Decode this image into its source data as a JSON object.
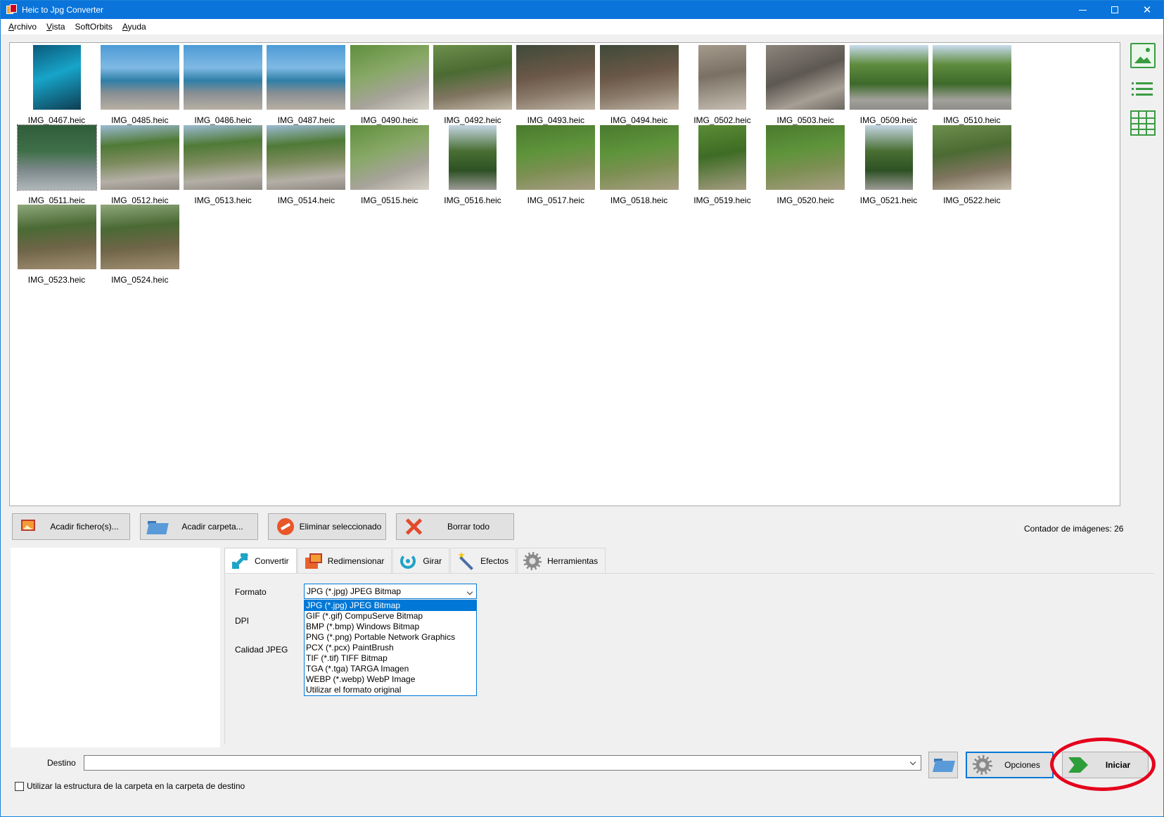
{
  "window": {
    "title": "Heic to Jpg Converter"
  },
  "menu": [
    {
      "u": "A",
      "rest": "rchivo"
    },
    {
      "u": "V",
      "rest": "ista"
    },
    {
      "u": "",
      "rest": "SoftOrbits"
    },
    {
      "u": "A",
      "rest": "yuda"
    }
  ],
  "thumbnails": [
    {
      "name": "IMG_0467.heic",
      "tone": "portrait-blue"
    },
    {
      "name": "IMG_0485.heic",
      "tone": "sea"
    },
    {
      "name": "IMG_0486.heic",
      "tone": "sea"
    },
    {
      "name": "IMG_0487.heic",
      "tone": "sea"
    },
    {
      "name": "IMG_0490.heic",
      "tone": "garden"
    },
    {
      "name": "IMG_0492.heic",
      "tone": "trees"
    },
    {
      "name": "IMG_0493.heic",
      "tone": "trees-dark"
    },
    {
      "name": "IMG_0494.heic",
      "tone": "trees-dark"
    },
    {
      "name": "IMG_0502.heic",
      "tone": "portrait-rock"
    },
    {
      "name": "IMG_0503.heic",
      "tone": "rock"
    },
    {
      "name": "IMG_0509.heic",
      "tone": "park"
    },
    {
      "name": "IMG_0510.heic",
      "tone": "park"
    },
    {
      "name": "IMG_0511.heic",
      "tone": "park-sel"
    },
    {
      "name": "IMG_0512.heic",
      "tone": "path"
    },
    {
      "name": "IMG_0513.heic",
      "tone": "path"
    },
    {
      "name": "IMG_0514.heic",
      "tone": "path"
    },
    {
      "name": "IMG_0515.heic",
      "tone": "garden"
    },
    {
      "name": "IMG_0516.heic",
      "tone": "portrait-park"
    },
    {
      "name": "IMG_0517.heic",
      "tone": "bush"
    },
    {
      "name": "IMG_0518.heic",
      "tone": "bush"
    },
    {
      "name": "IMG_0519.heic",
      "tone": "portrait-bush"
    },
    {
      "name": "IMG_0520.heic",
      "tone": "bush"
    },
    {
      "name": "IMG_0521.heic",
      "tone": "portrait-park"
    },
    {
      "name": "IMG_0522.heic",
      "tone": "trees"
    },
    {
      "name": "IMG_0523.heic",
      "tone": "forest"
    },
    {
      "name": "IMG_0524.heic",
      "tone": "forest"
    }
  ],
  "actions": {
    "add_files": "Acadir fichero(s)...",
    "add_folder": "Acadir carpeta...",
    "remove_selected": "Eliminar seleccionado",
    "clear_all": "Borrar todo",
    "counter": "Contador de imágenes: 26"
  },
  "tabs": [
    {
      "label": "Convertir",
      "icon": "convert-arrow-icon"
    },
    {
      "label": "Redimensionar",
      "icon": "resize-icon"
    },
    {
      "label": "Girar",
      "icon": "rotate-icon"
    },
    {
      "label": "Efectos",
      "icon": "magic-wand-icon"
    },
    {
      "label": "Herramientas",
      "icon": "gear-icon"
    }
  ],
  "convert": {
    "format_label": "Formato",
    "dpi_label": "DPI",
    "quality_label": "Calidad JPEG",
    "format_value": "JPG (*.jpg) JPEG Bitmap",
    "format_options": [
      "JPG (*.jpg) JPEG Bitmap",
      "GIF (*.gif) CompuServe Bitmap",
      "BMP (*.bmp) Windows Bitmap",
      "PNG (*.png) Portable Network Graphics",
      "PCX (*.pcx) PaintBrush",
      "TIF (*.tif) TIFF Bitmap",
      "TGA (*.tga) TARGA Imagen",
      "WEBP (*.webp) WebP Image",
      "Utilizar el formato original"
    ]
  },
  "bottom": {
    "dest_label": "Destino",
    "dest_value": "",
    "options_label": "Opciones",
    "start_label": "Iniciar",
    "folder_structure_label": "Utilizar la estructura de la carpeta en la carpeta de destino"
  },
  "colors": {
    "titlebar": "#0a74da",
    "accent": "#0078d7",
    "highlight_ring": "#e5001c",
    "icon_green": "#3a9b43"
  }
}
